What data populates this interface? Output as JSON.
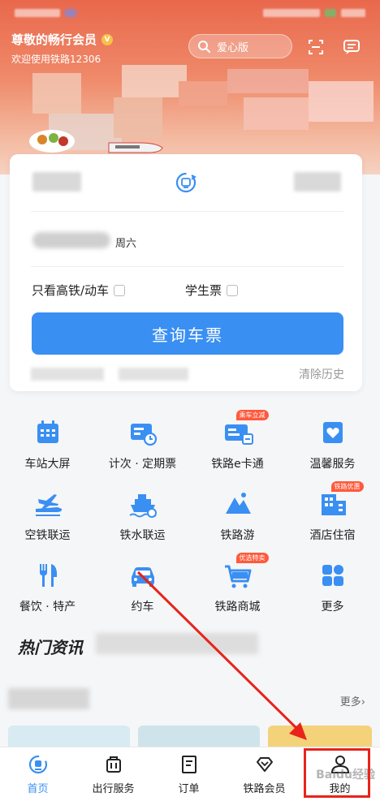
{
  "header": {
    "greeting": "尊敬的畅行会员",
    "vip_glyph": "V",
    "welcome": "欢迎使用铁路12306",
    "search_label": "爱心版",
    "scan_icon": "scan-icon",
    "message_icon": "message-icon"
  },
  "booking": {
    "weekday": "周六",
    "high_speed_only": "只看高铁/动车",
    "student_ticket": "学生票",
    "query_button": "查询车票",
    "clear_history": "清除历史"
  },
  "services": [
    {
      "label": "车站大屏",
      "icon": "calendar-screen-icon"
    },
    {
      "label": "计次 · 定期票",
      "icon": "ticket-card-icon"
    },
    {
      "label": "铁路e卡通",
      "icon": "e-card-icon",
      "tag": "乘车立减"
    },
    {
      "label": "温馨服务",
      "icon": "heart-box-icon"
    },
    {
      "label": "空铁联运",
      "icon": "plane-train-icon"
    },
    {
      "label": "铁水联运",
      "icon": "ship-train-icon"
    },
    {
      "label": "铁路游",
      "icon": "mountain-icon"
    },
    {
      "label": "酒店住宿",
      "icon": "hotel-icon",
      "tag": "铁路优惠"
    },
    {
      "label": "餐饮 · 特产",
      "icon": "fork-knife-icon"
    },
    {
      "label": "约车",
      "icon": "car-icon"
    },
    {
      "label": "铁路商城",
      "icon": "shopping-cart-icon",
      "tag": "优选特卖"
    },
    {
      "label": "更多",
      "icon": "more-grid-icon"
    }
  ],
  "news": {
    "hot_title": "热门资讯",
    "more": "更多",
    "more_glyph": "›"
  },
  "tabbar": [
    {
      "label": "首页",
      "icon": "home-train-icon",
      "active": true
    },
    {
      "label": "出行服务",
      "icon": "luggage-icon",
      "active": false
    },
    {
      "label": "订单",
      "icon": "order-icon",
      "active": false
    },
    {
      "label": "铁路会员",
      "icon": "diamond-icon",
      "active": false
    },
    {
      "label": "我的",
      "icon": "person-icon",
      "active": false
    }
  ],
  "watermark": "Baidu经验",
  "colors": {
    "accent": "#3a8ff2",
    "banner": "#e9684c",
    "tag": "#ff5a3c",
    "annotation": "#e8231a"
  }
}
